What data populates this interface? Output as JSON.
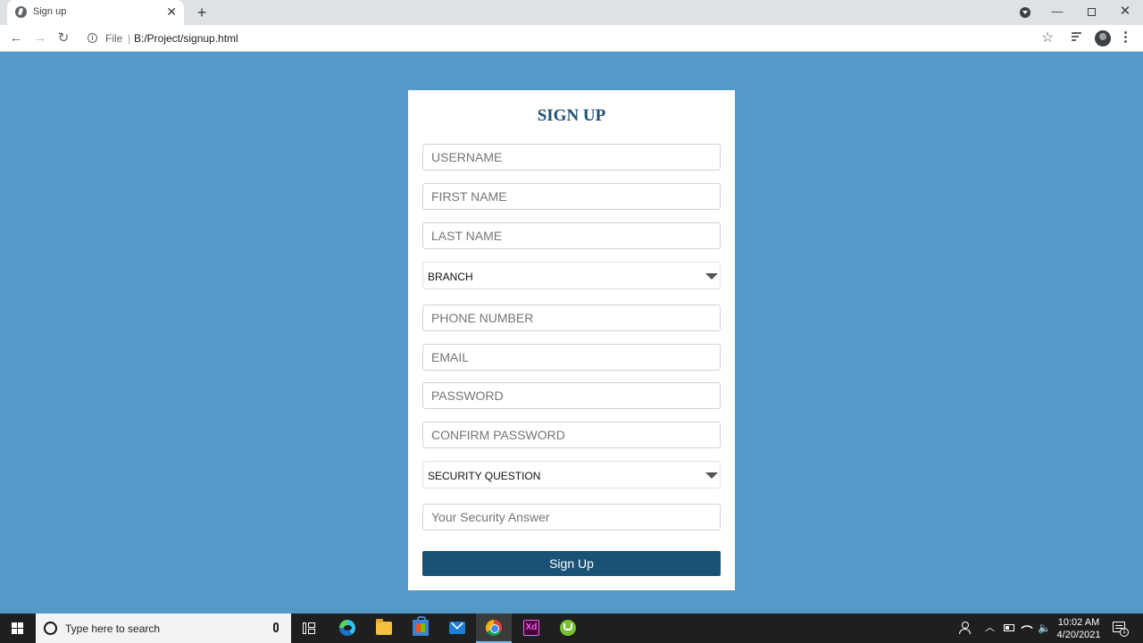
{
  "browser": {
    "tab": {
      "title": "Sign up"
    },
    "address_bar": {
      "scheme_label": "File",
      "url": "B:/Project/signup.html"
    }
  },
  "form": {
    "title": "SIGN UP",
    "fields": {
      "username": {
        "placeholder": "USERNAME",
        "value": ""
      },
      "first_name": {
        "placeholder": "FIRST NAME",
        "value": ""
      },
      "last_name": {
        "placeholder": "LAST NAME",
        "value": ""
      },
      "branch": {
        "selected": "BRANCH"
      },
      "phone": {
        "placeholder": "PHONE NUMBER",
        "value": ""
      },
      "email": {
        "placeholder": "EMAIL",
        "value": ""
      },
      "password": {
        "placeholder": "PASSWORD",
        "value": ""
      },
      "confirm_password": {
        "placeholder": "CONFIRM PASSWORD",
        "value": ""
      },
      "security_question": {
        "selected": "SECURITY QUESTION"
      },
      "security_answer": {
        "placeholder": "Your Security Answer",
        "value": ""
      }
    },
    "submit_label": "Sign Up"
  },
  "taskbar": {
    "search_placeholder": "Type here to search",
    "apps": [
      {
        "name": "Microsoft Edge",
        "icon": "edge-icon"
      },
      {
        "name": "File Explorer",
        "icon": "folder-icon"
      },
      {
        "name": "Microsoft Store",
        "icon": "store-icon"
      },
      {
        "name": "Mail",
        "icon": "mail-icon"
      },
      {
        "name": "Google Chrome",
        "icon": "chrome-icon",
        "active": true
      },
      {
        "name": "Adobe XD",
        "icon": "xd-icon",
        "glyph_text": "Xd"
      },
      {
        "name": "uTorrent",
        "icon": "utorrent-icon"
      }
    ],
    "clock": {
      "time": "10:02 AM",
      "date": "4/20/2021"
    },
    "notification_count": "1"
  },
  "colors": {
    "page_background": "#5599c9",
    "title_color": "#1e4f73",
    "button_background": "#1a5276"
  }
}
